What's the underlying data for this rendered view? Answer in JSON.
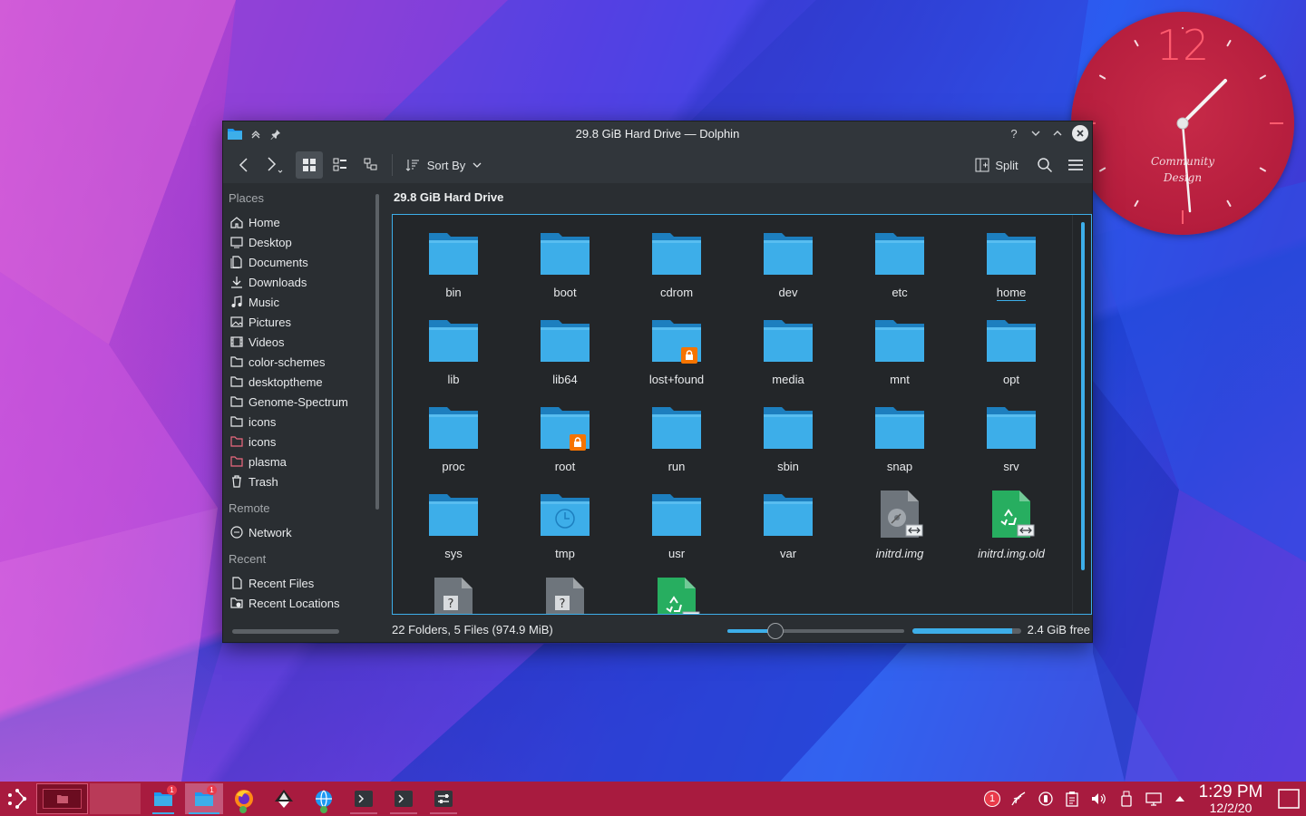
{
  "window": {
    "title": "29.8 GiB Hard Drive — Dolphin",
    "help_icon": "?",
    "path_label": "29.8 GiB Hard Drive"
  },
  "toolbar": {
    "sort_label": "Sort By",
    "split_label": "Split"
  },
  "sidebar": {
    "places_heading": "Places",
    "places": [
      {
        "label": "Home",
        "icon": "home-icon"
      },
      {
        "label": "Desktop",
        "icon": "desktop-icon"
      },
      {
        "label": "Documents",
        "icon": "documents-icon"
      },
      {
        "label": "Downloads",
        "icon": "downloads-icon"
      },
      {
        "label": "Music",
        "icon": "music-icon"
      },
      {
        "label": "Pictures",
        "icon": "pictures-icon"
      },
      {
        "label": "Videos",
        "icon": "videos-icon"
      },
      {
        "label": "color-schemes",
        "icon": "folder-icon"
      },
      {
        "label": "desktoptheme",
        "icon": "folder-icon"
      },
      {
        "label": "Genome-Spectrum",
        "icon": "folder-icon"
      },
      {
        "label": "icons",
        "icon": "folder-icon"
      },
      {
        "label": "icons",
        "icon": "folder-red-icon"
      },
      {
        "label": "plasma",
        "icon": "folder-red-icon"
      },
      {
        "label": "Trash",
        "icon": "trash-icon"
      }
    ],
    "remote_heading": "Remote",
    "remote": [
      {
        "label": "Network",
        "icon": "network-icon"
      }
    ],
    "recent_heading": "Recent",
    "recent": [
      {
        "label": "Recent Files",
        "icon": "recent-files-icon"
      },
      {
        "label": "Recent Locations",
        "icon": "recent-locations-icon"
      }
    ]
  },
  "files": [
    {
      "name": "bin",
      "type": "folder"
    },
    {
      "name": "boot",
      "type": "folder"
    },
    {
      "name": "cdrom",
      "type": "folder"
    },
    {
      "name": "dev",
      "type": "folder"
    },
    {
      "name": "etc",
      "type": "folder"
    },
    {
      "name": "home",
      "type": "folder"
    },
    {
      "name": "lib",
      "type": "folder"
    },
    {
      "name": "lib64",
      "type": "folder"
    },
    {
      "name": "lost+found",
      "type": "folder-locked"
    },
    {
      "name": "media",
      "type": "folder"
    },
    {
      "name": "mnt",
      "type": "folder"
    },
    {
      "name": "opt",
      "type": "folder"
    },
    {
      "name": "proc",
      "type": "folder"
    },
    {
      "name": "root",
      "type": "folder-locked"
    },
    {
      "name": "run",
      "type": "folder"
    },
    {
      "name": "sbin",
      "type": "folder"
    },
    {
      "name": "snap",
      "type": "folder"
    },
    {
      "name": "srv",
      "type": "folder"
    },
    {
      "name": "sys",
      "type": "folder"
    },
    {
      "name": "tmp",
      "type": "folder-temp"
    },
    {
      "name": "usr",
      "type": "folder"
    },
    {
      "name": "var",
      "type": "folder"
    },
    {
      "name": "initrd.img",
      "type": "disk-image-link"
    },
    {
      "name": "initrd.img.old",
      "type": "recycle-file-link"
    },
    {
      "name": "",
      "type": "unknown-file-locked"
    },
    {
      "name": "",
      "type": "unknown-file-locked"
    },
    {
      "name": "",
      "type": "recycle-file-link"
    }
  ],
  "status": {
    "summary": "22 Folders, 5 Files (974.9 MiB)",
    "zoom_fraction": 0.27,
    "used_fraction": 0.92,
    "free_label": "2.4 GiB free"
  },
  "clock_widget": {
    "twelve": "12",
    "brand_line1": "Community",
    "brand_line2": "Design"
  },
  "taskbar": {
    "time": "1:29 PM",
    "date": "12/2/20",
    "notification_count": "1",
    "task_badge": "1"
  },
  "colors": {
    "accent": "#3daee9",
    "folder": "#3daee9",
    "taskbar": "#a81b3f",
    "lock": "#f67400",
    "clock_face": "#b51d3d"
  }
}
